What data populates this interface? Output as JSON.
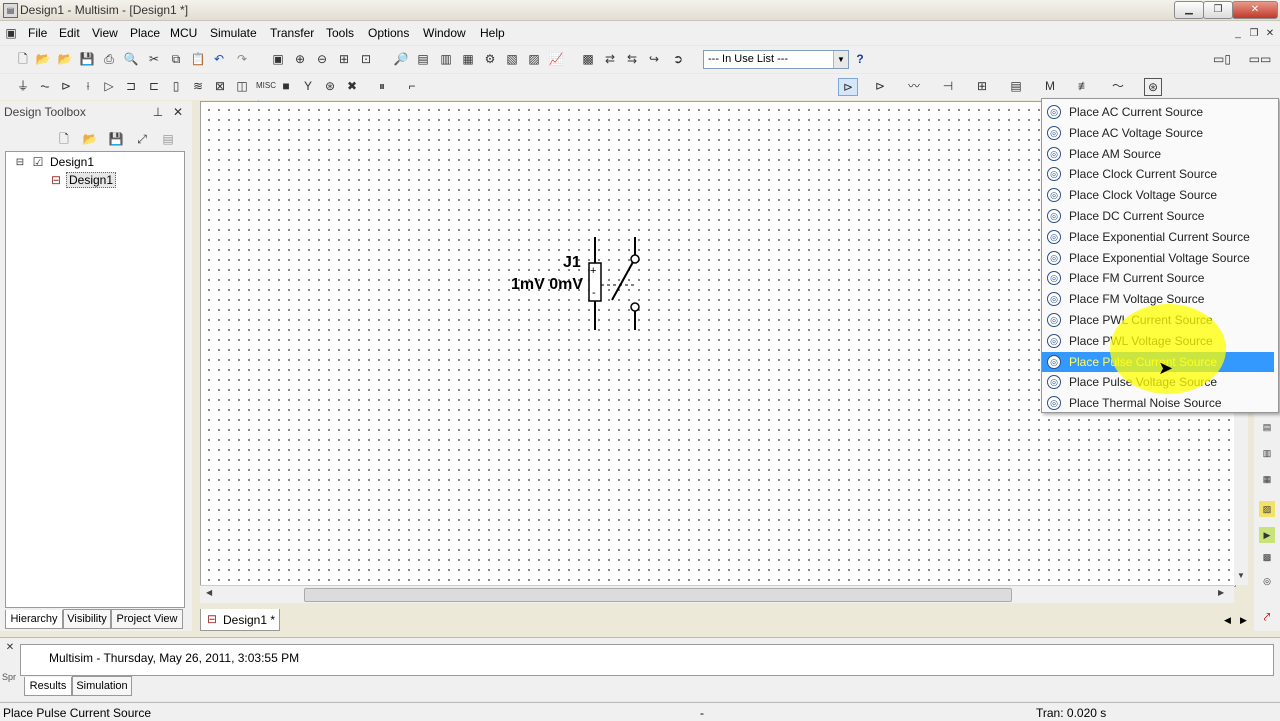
{
  "window": {
    "title": "Design1 - Multisim - [Design1 *]",
    "app_icon": "multisim-icon",
    "controls": [
      "minimize",
      "restore",
      "close"
    ]
  },
  "menu": [
    "File",
    "Edit",
    "View",
    "Place",
    "MCU",
    "Simulate",
    "Transfer",
    "Tools",
    "Options",
    "Window",
    "Help"
  ],
  "toolbar": {
    "in_use_list": "--- In Use List ---",
    "help_icon": "?"
  },
  "design_toolbox": {
    "title": "Design Toolbox",
    "tree": [
      {
        "label": "Design1",
        "level": 0,
        "icon": "design-check-icon"
      },
      {
        "label": "Design1",
        "level": 1,
        "icon": "schematic-sheet-icon",
        "selected": true
      }
    ],
    "tabs": [
      "Hierarchy",
      "Visibility",
      "Project View"
    ]
  },
  "schematic": {
    "component_ref": "J1",
    "component_value": "1mV 0mV"
  },
  "source_menu": {
    "items": [
      "Place AC Current Source",
      "Place AC Voltage Source",
      "Place AM Source",
      "Place Clock Current Source",
      "Place Clock Voltage Source",
      "Place DC Current Source",
      "Place Exponential Current Source",
      "Place Exponential Voltage Source",
      "Place FM Current Source",
      "Place FM Voltage Source",
      "Place PWL Current Source",
      "Place PWL Voltage Source",
      "Place Pulse Current Source",
      "Place Pulse Voltage Source",
      "Place Thermal Noise Source"
    ],
    "highlighted_index": 12,
    "highlight_color": "#3399ff",
    "highlight_text_color": "#ffff66"
  },
  "document_tab": "Design1 *",
  "spreadsheet": {
    "message": "Multisim  -  Thursday, May 26, 2011, 3:03:55 PM",
    "tabs": [
      "Results",
      "Simulation"
    ],
    "side_label": "Spr"
  },
  "statusbar": {
    "left": "Place Pulse Current Source",
    "middle": "-",
    "right": "Tran: 0.020 s"
  }
}
